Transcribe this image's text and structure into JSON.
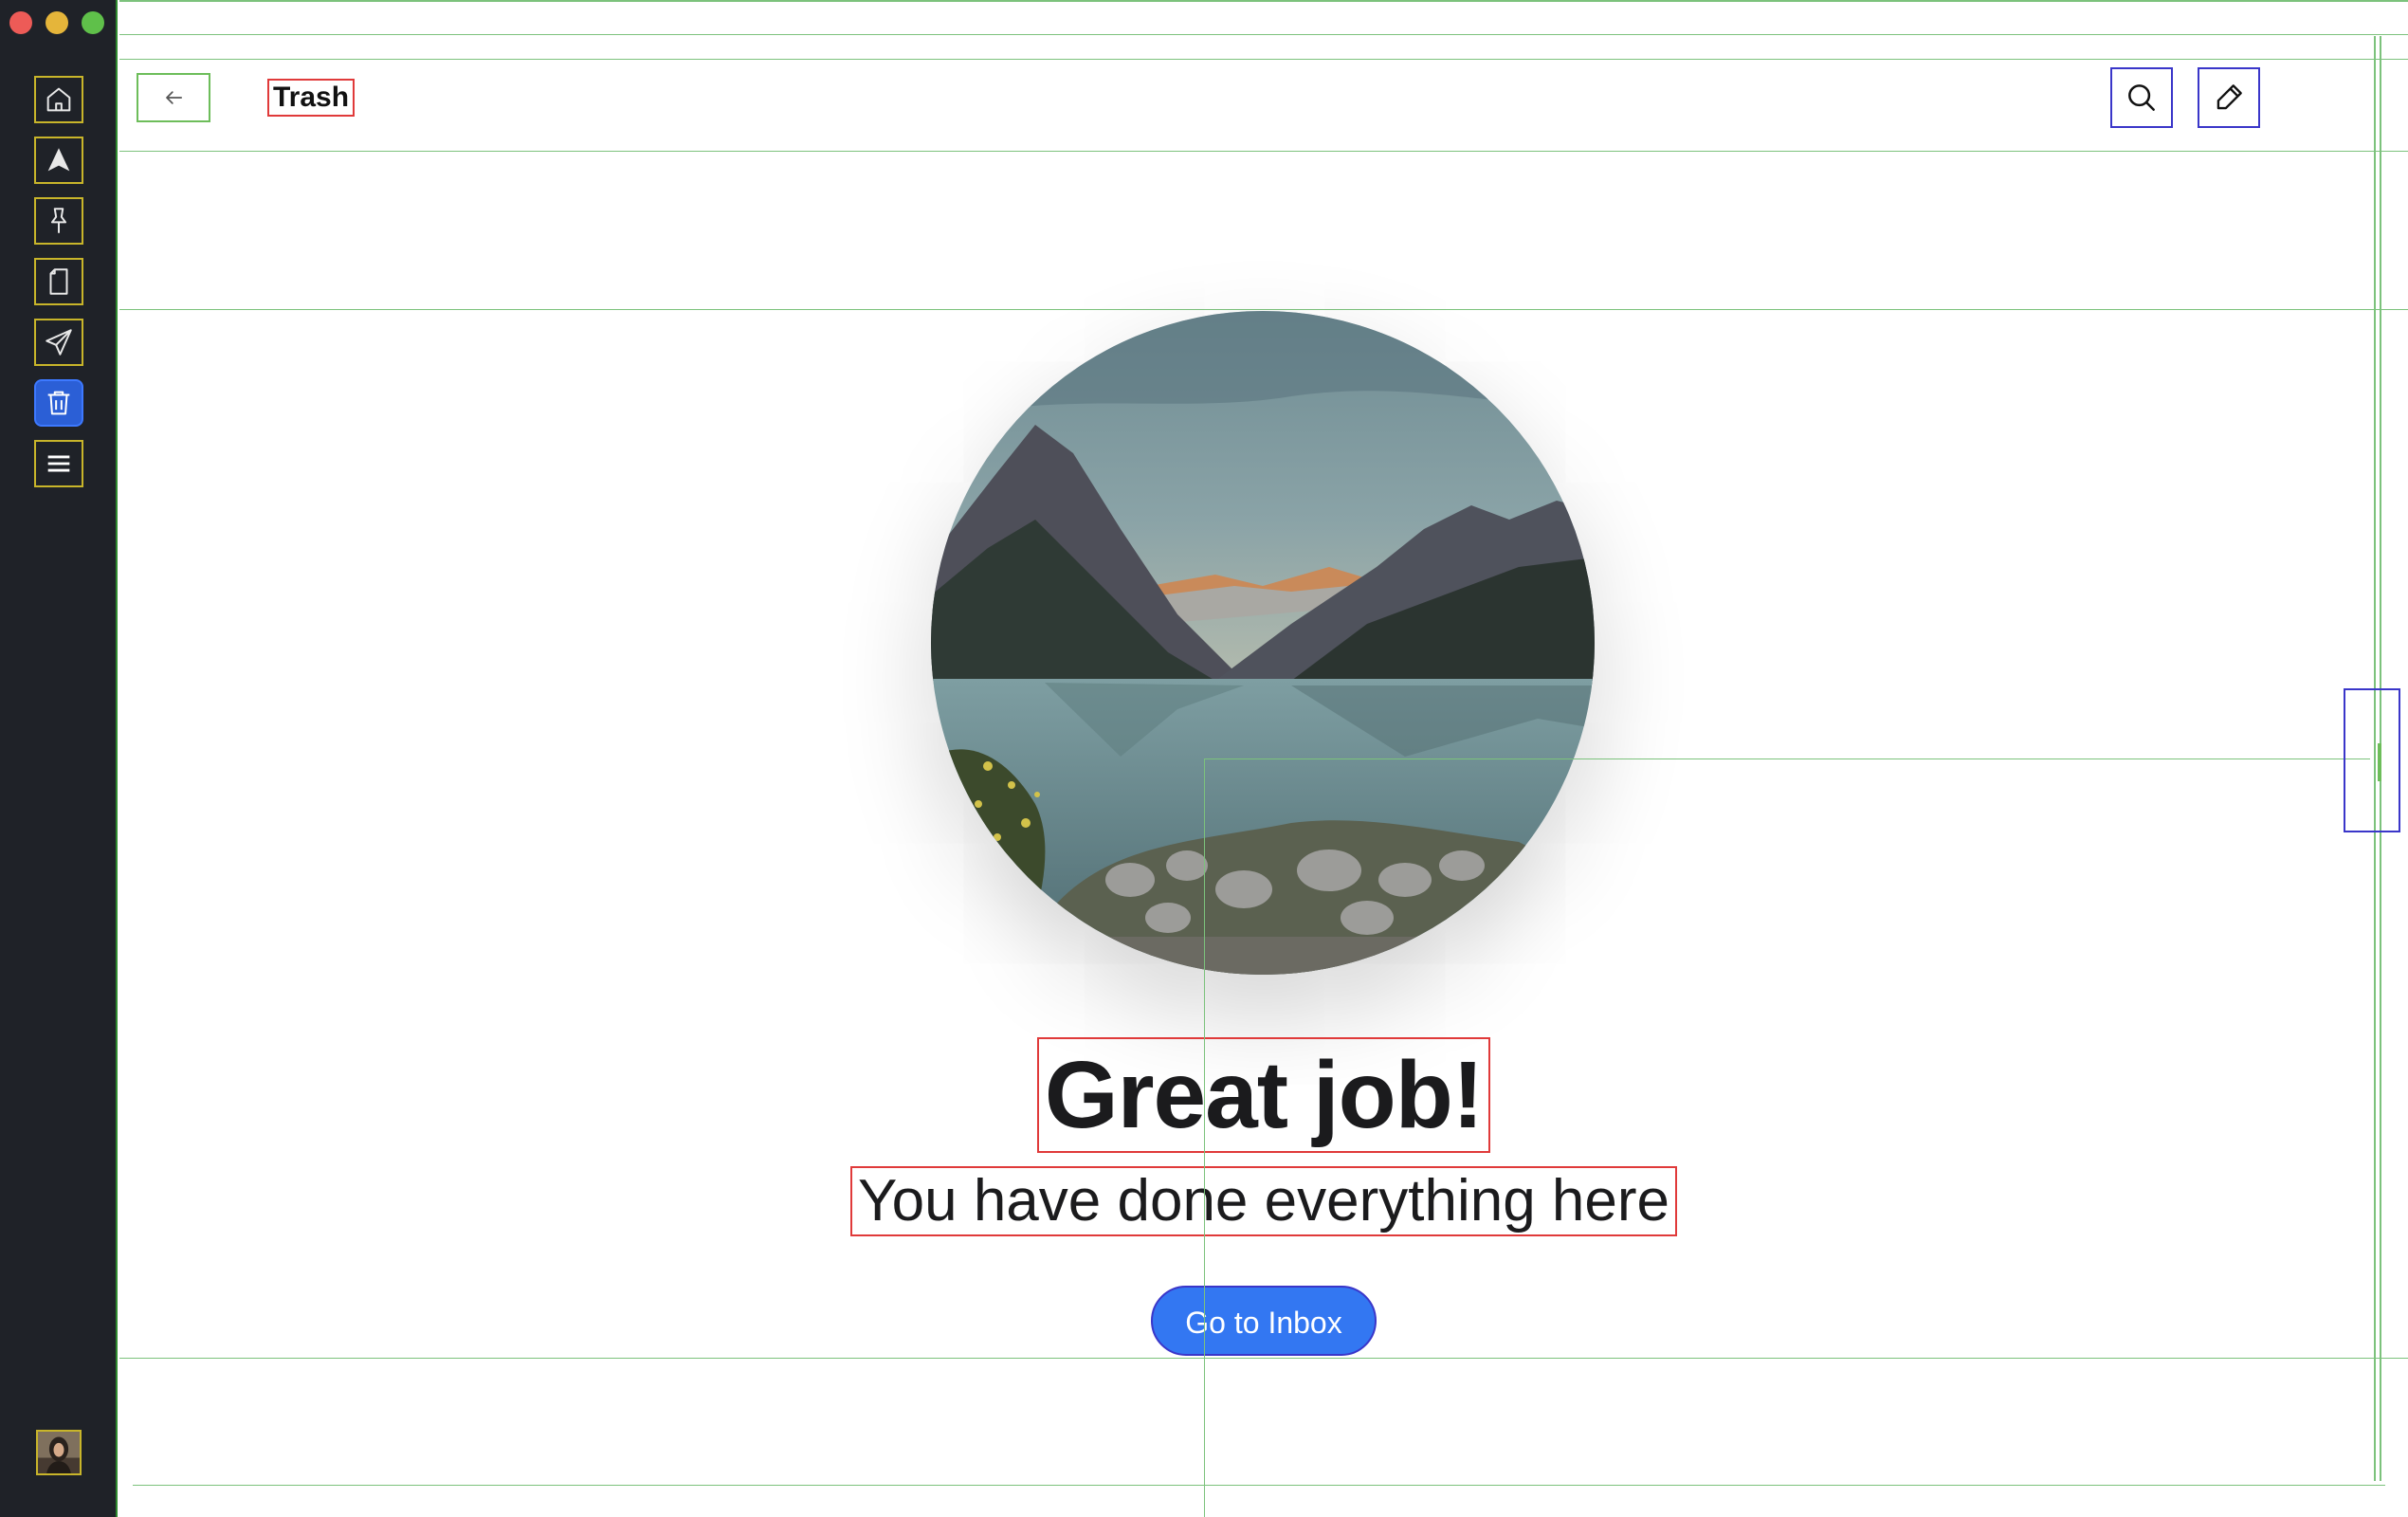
{
  "window": {
    "controls": [
      "close",
      "minimize",
      "zoom"
    ]
  },
  "sidebar": {
    "items": [
      {
        "name": "home",
        "icon": "home-icon"
      },
      {
        "name": "navigation",
        "icon": "navigation-arrow-icon"
      },
      {
        "name": "pinned",
        "icon": "pin-icon"
      },
      {
        "name": "drafts",
        "icon": "document-icon"
      },
      {
        "name": "sent",
        "icon": "send-icon"
      },
      {
        "name": "trash",
        "icon": "trash-icon",
        "active": true
      },
      {
        "name": "menu",
        "icon": "hamburger-menu-icon"
      }
    ],
    "avatar": "user-avatar"
  },
  "header": {
    "title": "Trash",
    "back_icon": "arrow-left-icon",
    "actions": [
      {
        "name": "search",
        "icon": "search-icon"
      },
      {
        "name": "compose",
        "icon": "pencil-icon"
      }
    ]
  },
  "empty_state": {
    "headline": "Great job!",
    "message": "You have done everything here",
    "button_label": "Go to Inbox"
  },
  "colors": {
    "sidebar_bg": "#1f2228",
    "accent": "#3377f2",
    "active_nav": "#2b5fd6",
    "text": "#1b1b1d"
  }
}
